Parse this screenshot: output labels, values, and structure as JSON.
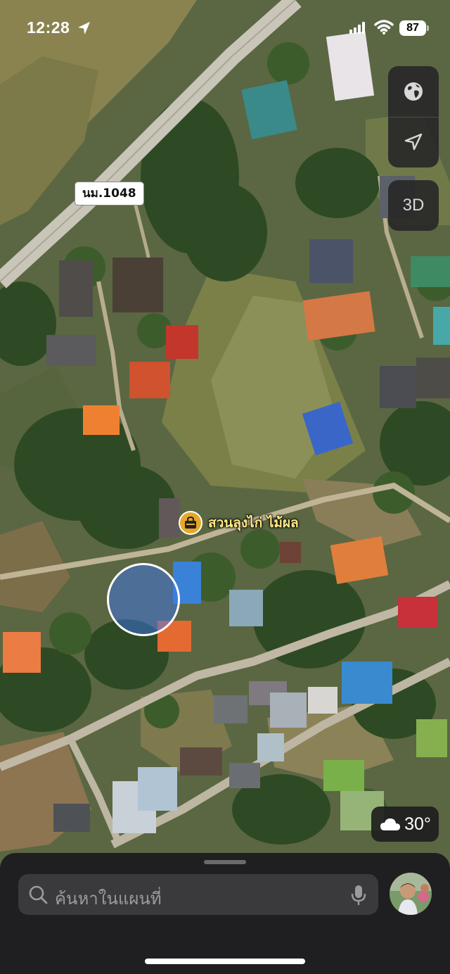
{
  "status_bar": {
    "time": "12:28",
    "battery": "87"
  },
  "map": {
    "road_label": "นม.1048",
    "poi": {
      "name": "สวนลุงไก่ ไม้ผล",
      "icon": "shopping-bag-icon",
      "color": "#e6a82a"
    }
  },
  "controls": {
    "map_mode_icon": "globe-icon",
    "locate_icon": "location-arrow-icon",
    "three_d_label": "3D"
  },
  "weather": {
    "icon": "cloud-icon",
    "temperature": "30°"
  },
  "search": {
    "placeholder": "ค้นหาในแผนที่"
  }
}
